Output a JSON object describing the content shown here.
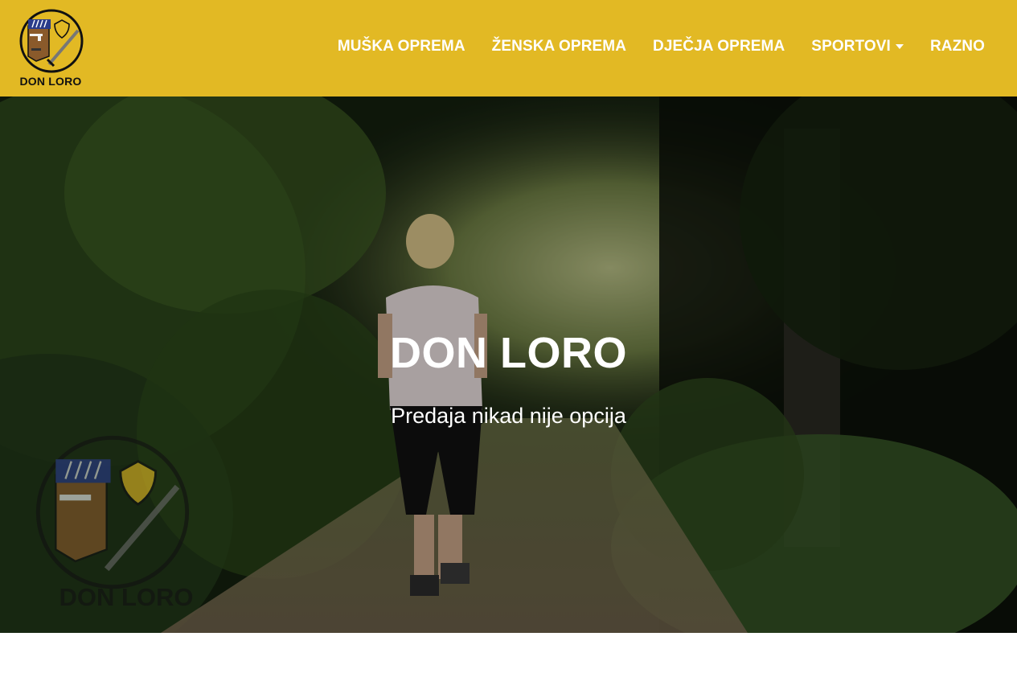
{
  "header": {
    "brand_text": "DON LORO",
    "nav": [
      {
        "label": "MUŠKA OPREMA"
      },
      {
        "label": "ŽENSKA OPREMA"
      },
      {
        "label": "DJEČJA OPREMA"
      },
      {
        "label": "SPORTOVI"
      },
      {
        "label": "RAZNO"
      }
    ]
  },
  "hero": {
    "title": "DON LORO",
    "subtitle": "Predaja nikad nije opcija",
    "watermark_text": "DON LORO"
  },
  "colors": {
    "navbar": "#e2b924",
    "nav_text": "#ffffff",
    "hero_text": "#ffffff"
  },
  "icons": {
    "logo": "don-loro-logo",
    "dropdown": "caret-down-icon"
  }
}
